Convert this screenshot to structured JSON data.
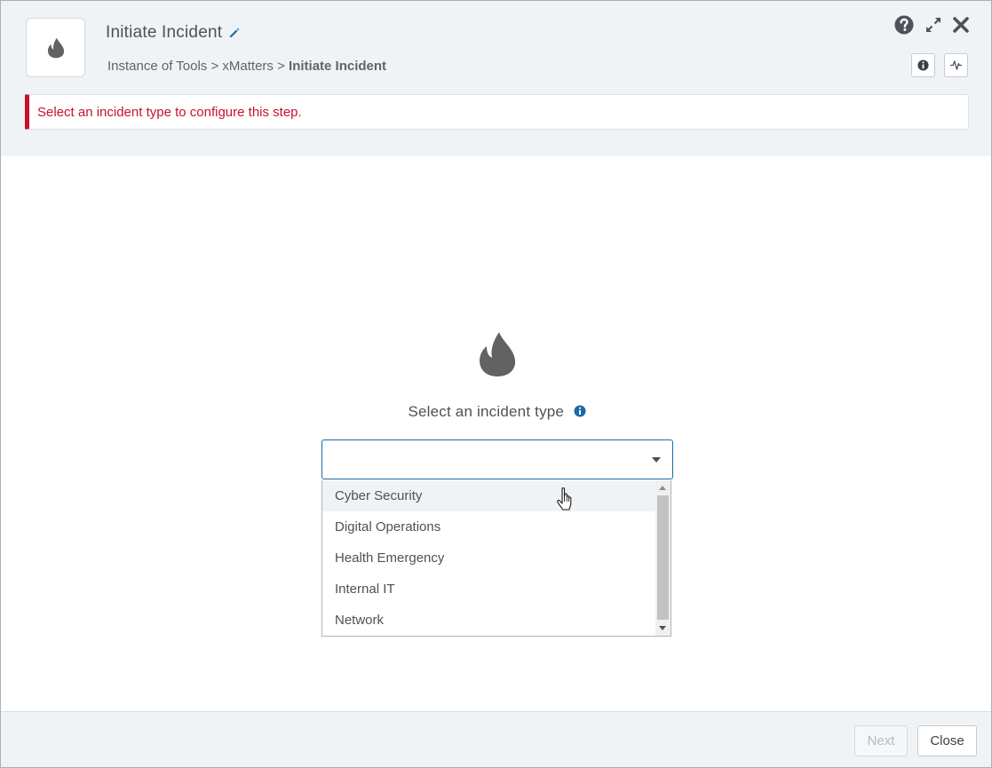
{
  "header": {
    "title": "Initiate Incident",
    "breadcrumb": {
      "part1": "Instance of Tools",
      "sep1": " > ",
      "part2": "xMatters",
      "sep2": " > ",
      "current": "Initiate Incident"
    }
  },
  "alert": {
    "message": "Select an incident type to configure this step."
  },
  "main": {
    "select_label": "Select an incident type",
    "selected_value": "",
    "options": [
      "Cyber Security",
      "Digital Operations",
      "Health Emergency",
      "Internal IT",
      "Network"
    ],
    "hovered_option": "Cyber Security"
  },
  "footer": {
    "next_label": "Next",
    "close_label": "Close"
  },
  "icons": {
    "step": "flame-icon",
    "edit": "pencil-icon",
    "help": "question-circle-icon",
    "expand": "expand-icon",
    "close": "close-icon",
    "info": "info-icon",
    "activity": "activity-icon"
  },
  "colors": {
    "accent": "#1b6aa3",
    "error": "#c8102e",
    "header_bg": "#eff3f6",
    "icon_gray": "#626262"
  }
}
